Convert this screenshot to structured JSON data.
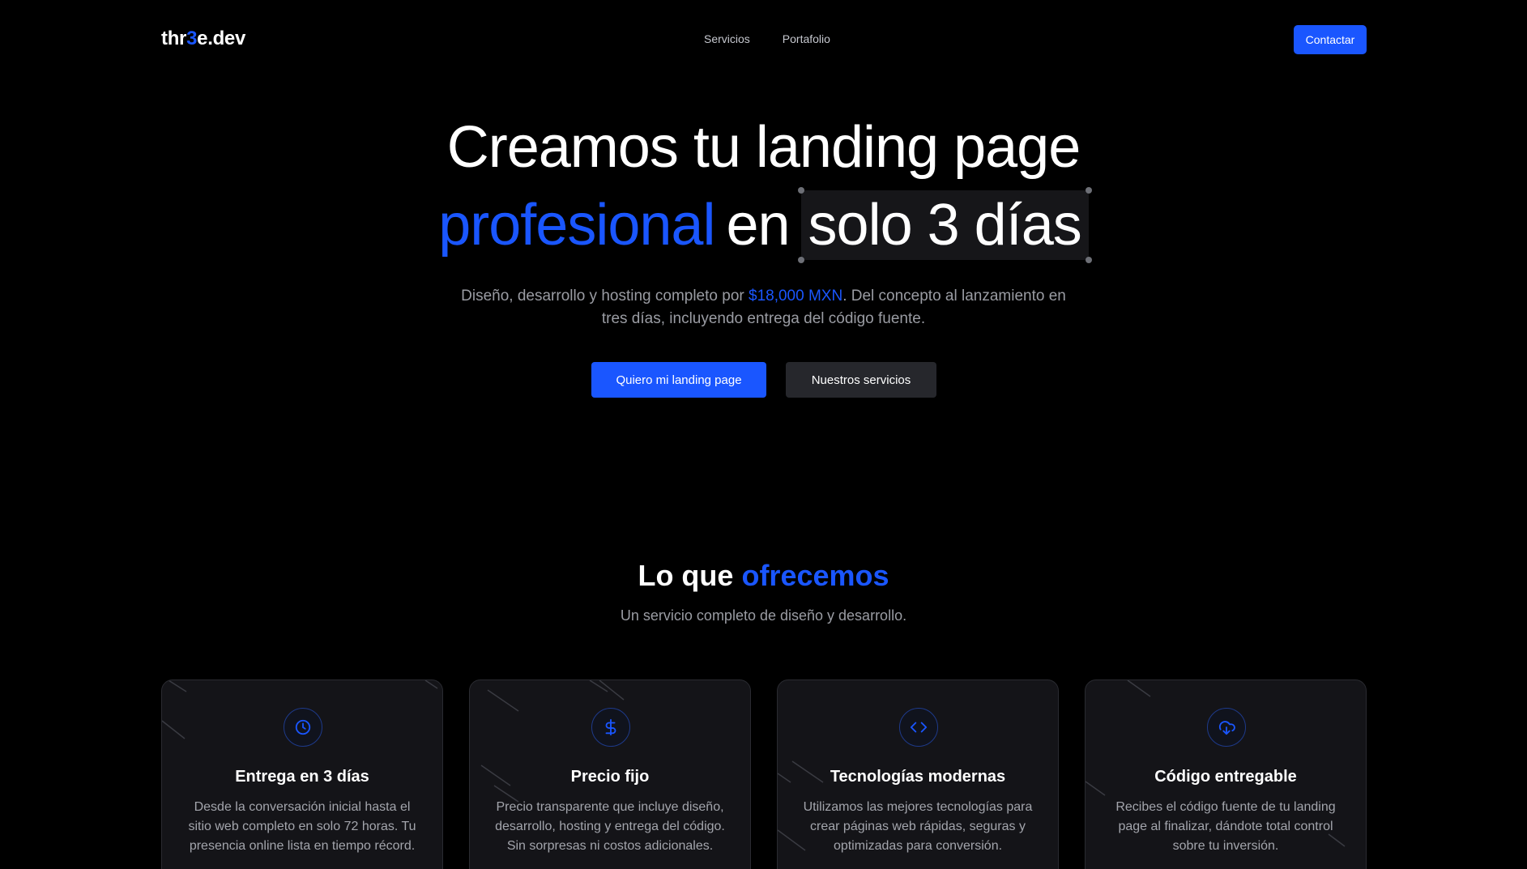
{
  "nav": {
    "logo_prefix": "thr",
    "logo_accent": "3",
    "logo_suffix": "e.dev",
    "links": [
      "Servicios",
      "Portafolio"
    ],
    "contact_label": "Contactar"
  },
  "hero": {
    "line1": "Creamos tu landing page",
    "line2_accent": "profesional",
    "line2_mid": "en",
    "line2_highlight": "solo 3 días",
    "sub_before": "Diseño, desarrollo y hosting completo por ",
    "sub_price": "$18,000 MXN",
    "sub_after": ". Del concepto al lanzamiento en tres días, incluyendo entrega del código fuente.",
    "cta_primary": "Quiero mi landing page",
    "cta_secondary": "Nuestros servicios"
  },
  "services": {
    "title_plain": "Lo que ",
    "title_accent": "ofrecemos",
    "subtitle": "Un servicio completo de diseño y desarrollo.",
    "cards": [
      {
        "icon": "clock-icon",
        "title": "Entrega en 3 días",
        "desc": "Desde la conversación inicial hasta el sitio web completo en solo 72 horas. Tu presencia online lista en tiempo récord."
      },
      {
        "icon": "dollar-icon",
        "title": "Precio fijo",
        "desc": "Precio transparente que incluye diseño, desarrollo, hosting y entrega del código. Sin sorpresas ni costos adicionales."
      },
      {
        "icon": "code-icon",
        "title": "Tecnologías modernas",
        "desc": "Utilizamos las mejores tecnologías para crear páginas web rápidas, seguras y optimizadas para conversión."
      },
      {
        "icon": "cloud-download-icon",
        "title": "Código entregable",
        "desc": "Recibes el código fuente de tu landing page al finalizar, dándote total control sobre tu inversión."
      }
    ]
  },
  "colors": {
    "accent": "#1a56ff",
    "background": "#000000",
    "card": "#141418",
    "muted_text": "#9a9ca3"
  }
}
